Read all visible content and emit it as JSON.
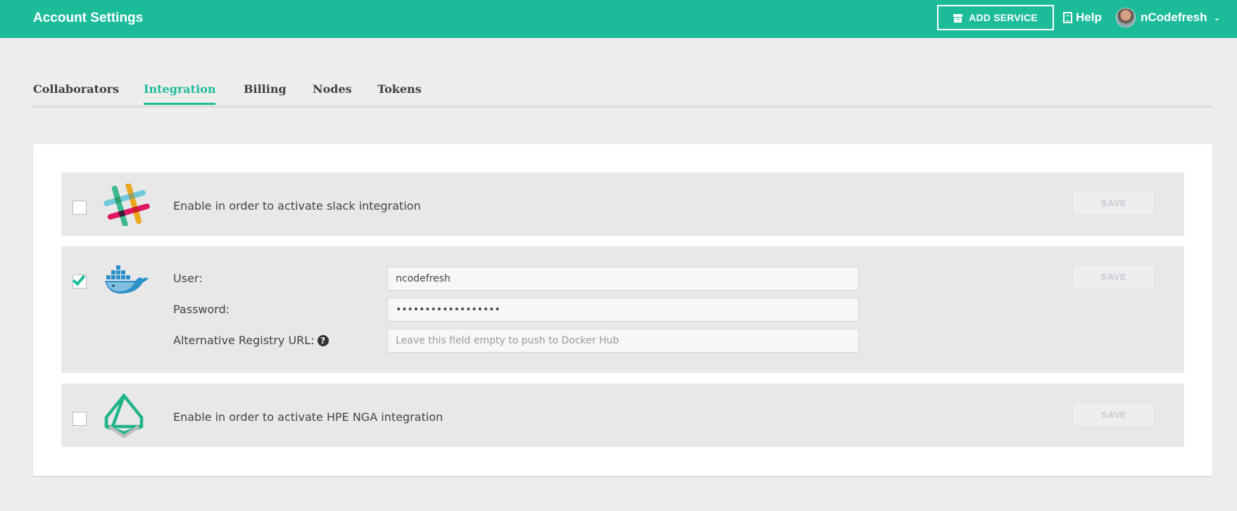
{
  "header": {
    "title": "Account Settings",
    "add_service_label": "ADD SERVICE",
    "help_label": "Help",
    "username": "nCodefresh"
  },
  "tabs": [
    {
      "label": "Collaborators",
      "active": false
    },
    {
      "label": "Integration",
      "active": true
    },
    {
      "label": "Billing",
      "active": false
    },
    {
      "label": "Nodes",
      "active": false
    },
    {
      "label": "Tokens",
      "active": false
    }
  ],
  "integrations": {
    "slack": {
      "enabled": false,
      "description": "Enable in order to activate slack integration",
      "save_label": "SAVE",
      "icon": "slack-logo"
    },
    "docker": {
      "enabled": true,
      "icon": "docker-logo",
      "save_label": "SAVE",
      "user_label": "User:",
      "user_value": "ncodefresh",
      "password_label": "Password:",
      "password_value": "••••••••••••••••••",
      "registry_label": "Alternative Registry URL:",
      "registry_value": "",
      "registry_placeholder": "Leave this field empty to push to Docker Hub"
    },
    "hpe_nga": {
      "enabled": false,
      "description": "Enable in order to activate HPE NGA integration",
      "save_label": "SAVE",
      "icon": "hpe-nga-logo"
    }
  },
  "colors": {
    "accent": "#1cbc9b",
    "background": "#eeeded",
    "row_background": "#e8e8e8"
  }
}
